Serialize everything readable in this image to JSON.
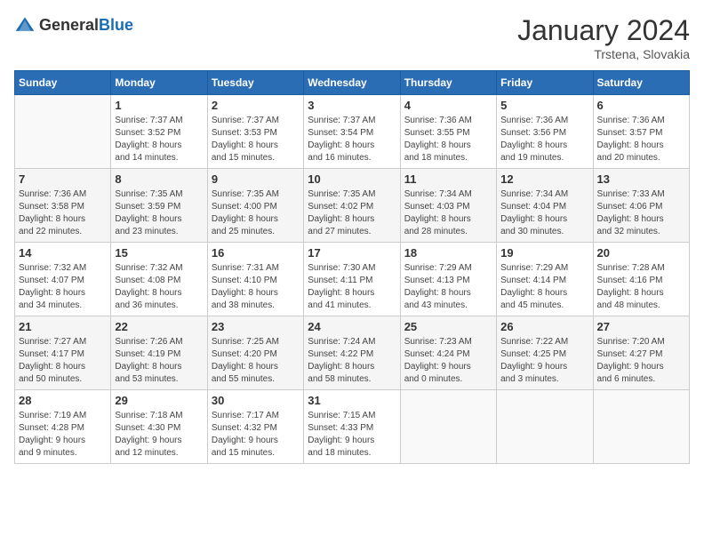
{
  "header": {
    "logo_general": "General",
    "logo_blue": "Blue",
    "title": "January 2024",
    "subtitle": "Trstena, Slovakia"
  },
  "days_of_week": [
    "Sunday",
    "Monday",
    "Tuesday",
    "Wednesday",
    "Thursday",
    "Friday",
    "Saturday"
  ],
  "weeks": [
    [
      {
        "day": "",
        "info": ""
      },
      {
        "day": "1",
        "info": "Sunrise: 7:37 AM\nSunset: 3:52 PM\nDaylight: 8 hours\nand 14 minutes."
      },
      {
        "day": "2",
        "info": "Sunrise: 7:37 AM\nSunset: 3:53 PM\nDaylight: 8 hours\nand 15 minutes."
      },
      {
        "day": "3",
        "info": "Sunrise: 7:37 AM\nSunset: 3:54 PM\nDaylight: 8 hours\nand 16 minutes."
      },
      {
        "day": "4",
        "info": "Sunrise: 7:36 AM\nSunset: 3:55 PM\nDaylight: 8 hours\nand 18 minutes."
      },
      {
        "day": "5",
        "info": "Sunrise: 7:36 AM\nSunset: 3:56 PM\nDaylight: 8 hours\nand 19 minutes."
      },
      {
        "day": "6",
        "info": "Sunrise: 7:36 AM\nSunset: 3:57 PM\nDaylight: 8 hours\nand 20 minutes."
      }
    ],
    [
      {
        "day": "7",
        "info": "Sunrise: 7:36 AM\nSunset: 3:58 PM\nDaylight: 8 hours\nand 22 minutes."
      },
      {
        "day": "8",
        "info": "Sunrise: 7:35 AM\nSunset: 3:59 PM\nDaylight: 8 hours\nand 23 minutes."
      },
      {
        "day": "9",
        "info": "Sunrise: 7:35 AM\nSunset: 4:00 PM\nDaylight: 8 hours\nand 25 minutes."
      },
      {
        "day": "10",
        "info": "Sunrise: 7:35 AM\nSunset: 4:02 PM\nDaylight: 8 hours\nand 27 minutes."
      },
      {
        "day": "11",
        "info": "Sunrise: 7:34 AM\nSunset: 4:03 PM\nDaylight: 8 hours\nand 28 minutes."
      },
      {
        "day": "12",
        "info": "Sunrise: 7:34 AM\nSunset: 4:04 PM\nDaylight: 8 hours\nand 30 minutes."
      },
      {
        "day": "13",
        "info": "Sunrise: 7:33 AM\nSunset: 4:06 PM\nDaylight: 8 hours\nand 32 minutes."
      }
    ],
    [
      {
        "day": "14",
        "info": "Sunrise: 7:32 AM\nSunset: 4:07 PM\nDaylight: 8 hours\nand 34 minutes."
      },
      {
        "day": "15",
        "info": "Sunrise: 7:32 AM\nSunset: 4:08 PM\nDaylight: 8 hours\nand 36 minutes."
      },
      {
        "day": "16",
        "info": "Sunrise: 7:31 AM\nSunset: 4:10 PM\nDaylight: 8 hours\nand 38 minutes."
      },
      {
        "day": "17",
        "info": "Sunrise: 7:30 AM\nSunset: 4:11 PM\nDaylight: 8 hours\nand 41 minutes."
      },
      {
        "day": "18",
        "info": "Sunrise: 7:29 AM\nSunset: 4:13 PM\nDaylight: 8 hours\nand 43 minutes."
      },
      {
        "day": "19",
        "info": "Sunrise: 7:29 AM\nSunset: 4:14 PM\nDaylight: 8 hours\nand 45 minutes."
      },
      {
        "day": "20",
        "info": "Sunrise: 7:28 AM\nSunset: 4:16 PM\nDaylight: 8 hours\nand 48 minutes."
      }
    ],
    [
      {
        "day": "21",
        "info": "Sunrise: 7:27 AM\nSunset: 4:17 PM\nDaylight: 8 hours\nand 50 minutes."
      },
      {
        "day": "22",
        "info": "Sunrise: 7:26 AM\nSunset: 4:19 PM\nDaylight: 8 hours\nand 53 minutes."
      },
      {
        "day": "23",
        "info": "Sunrise: 7:25 AM\nSunset: 4:20 PM\nDaylight: 8 hours\nand 55 minutes."
      },
      {
        "day": "24",
        "info": "Sunrise: 7:24 AM\nSunset: 4:22 PM\nDaylight: 8 hours\nand 58 minutes."
      },
      {
        "day": "25",
        "info": "Sunrise: 7:23 AM\nSunset: 4:24 PM\nDaylight: 9 hours\nand 0 minutes."
      },
      {
        "day": "26",
        "info": "Sunrise: 7:22 AM\nSunset: 4:25 PM\nDaylight: 9 hours\nand 3 minutes."
      },
      {
        "day": "27",
        "info": "Sunrise: 7:20 AM\nSunset: 4:27 PM\nDaylight: 9 hours\nand 6 minutes."
      }
    ],
    [
      {
        "day": "28",
        "info": "Sunrise: 7:19 AM\nSunset: 4:28 PM\nDaylight: 9 hours\nand 9 minutes."
      },
      {
        "day": "29",
        "info": "Sunrise: 7:18 AM\nSunset: 4:30 PM\nDaylight: 9 hours\nand 12 minutes."
      },
      {
        "day": "30",
        "info": "Sunrise: 7:17 AM\nSunset: 4:32 PM\nDaylight: 9 hours\nand 15 minutes."
      },
      {
        "day": "31",
        "info": "Sunrise: 7:15 AM\nSunset: 4:33 PM\nDaylight: 9 hours\nand 18 minutes."
      },
      {
        "day": "",
        "info": ""
      },
      {
        "day": "",
        "info": ""
      },
      {
        "day": "",
        "info": ""
      }
    ]
  ]
}
